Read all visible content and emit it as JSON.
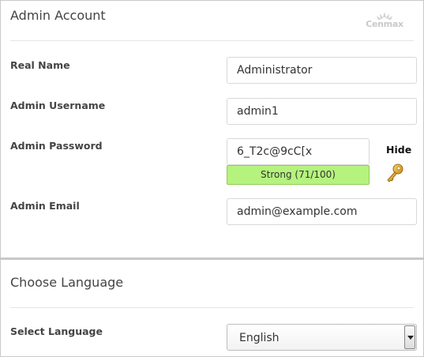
{
  "admin_account": {
    "title": "Admin Account",
    "logo_text": "Cenmax",
    "real_name": {
      "label": "Real Name",
      "value": "Administrator"
    },
    "username": {
      "label": "Admin Username",
      "value": "admin1"
    },
    "password": {
      "label": "Admin Password",
      "value": "6_T2c@9cC[x",
      "strength_text": "Strong (71/100)",
      "strength_score": 71,
      "strength_max": 100,
      "strength_color": "#b6f27e",
      "hide_label": "Hide",
      "generate_icon": "key-icon"
    },
    "email": {
      "label": "Admin Email",
      "value": "admin@example.com"
    }
  },
  "language": {
    "title": "Choose Language",
    "select_label": "Select Language",
    "selected": "English"
  }
}
